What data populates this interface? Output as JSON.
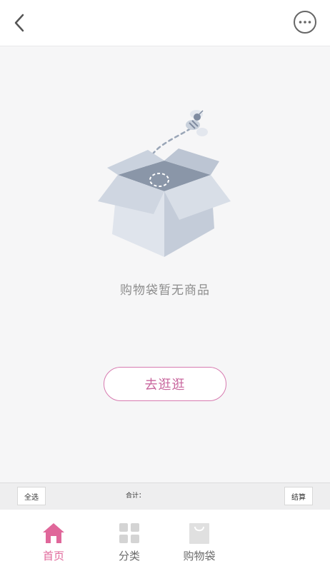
{
  "header": {
    "back_icon": "back-arrow-icon",
    "more_icon": "more-dots-icon"
  },
  "empty": {
    "message": "购物袋暂无商品",
    "button_label": "去逛逛"
  },
  "summary": {
    "select_all": "全选",
    "total_label": "合计：",
    "checkout": "结算"
  },
  "tabbar": {
    "items": [
      {
        "label": "首页",
        "icon": "home-icon",
        "active": true
      },
      {
        "label": "分类",
        "icon": "grid-icon",
        "active": false
      },
      {
        "label": "购物袋",
        "icon": "bag-icon",
        "active": false
      }
    ]
  },
  "colors": {
    "accent": "#e0679a",
    "button_border": "#d77bb0"
  }
}
